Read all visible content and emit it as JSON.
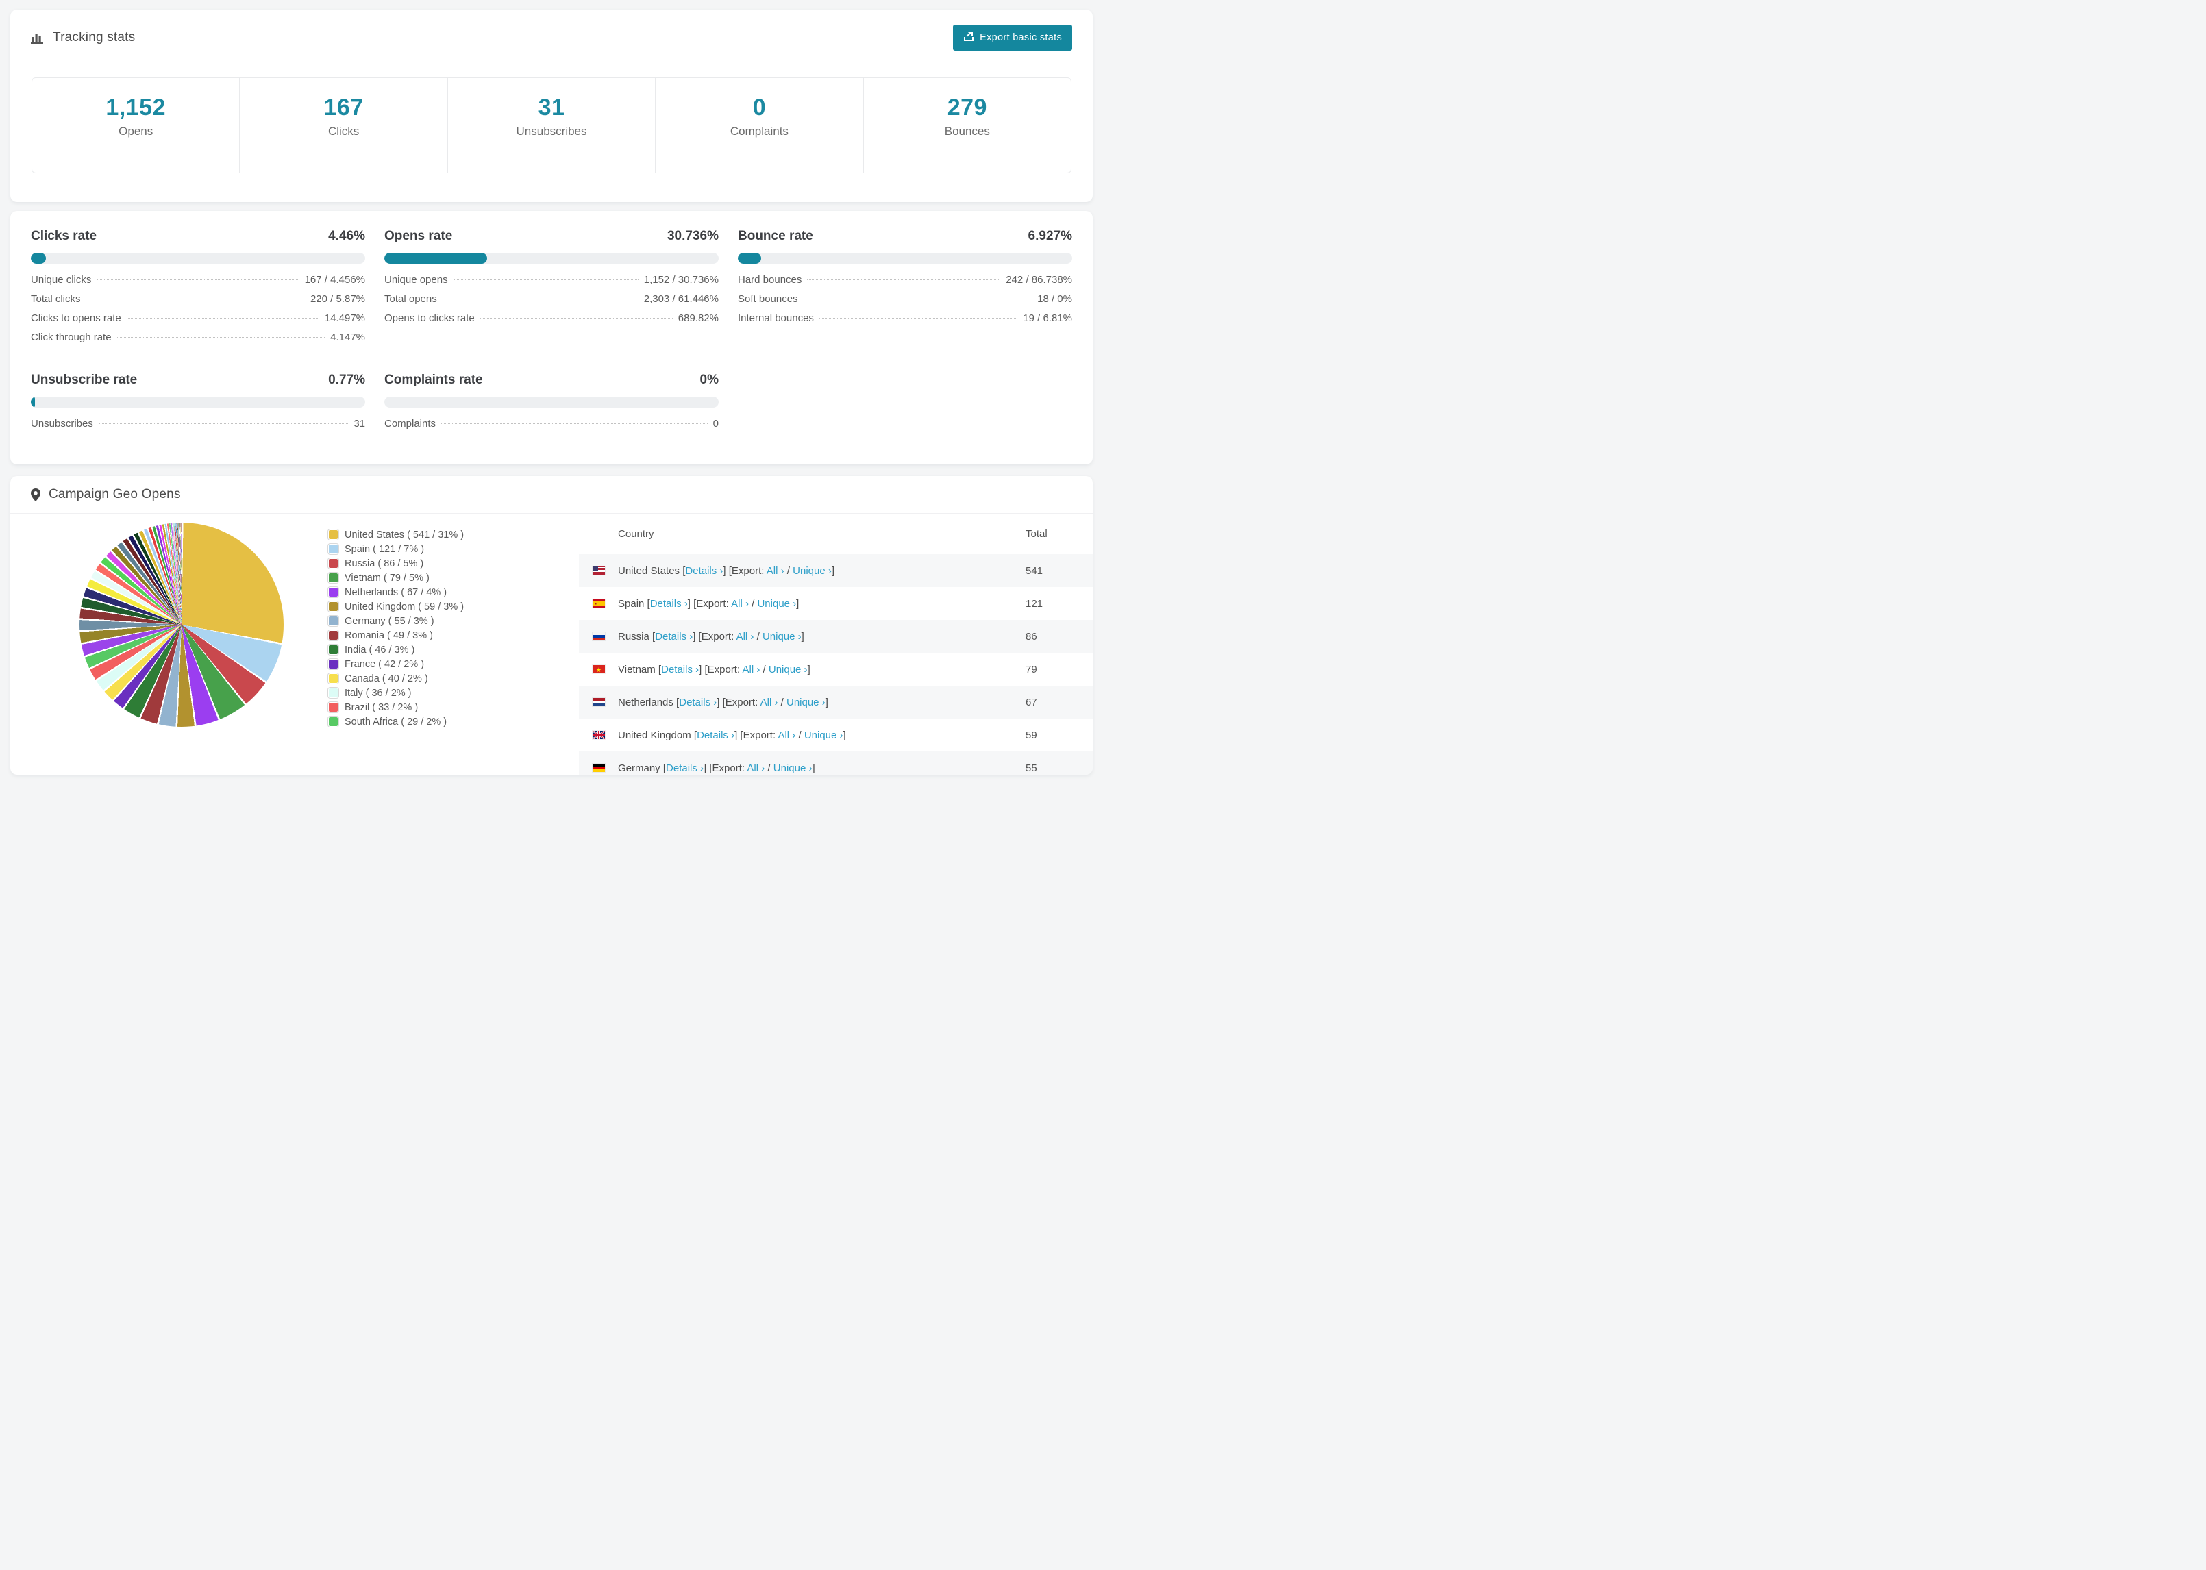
{
  "accent_color": "#14879e",
  "link_color": "#2e9fc9",
  "tracking": {
    "title": "Tracking stats",
    "export_button": "Export basic stats",
    "stats": [
      {
        "value": "1,152",
        "label": "Opens"
      },
      {
        "value": "167",
        "label": "Clicks"
      },
      {
        "value": "31",
        "label": "Unsubscribes"
      },
      {
        "value": "0",
        "label": "Complaints"
      },
      {
        "value": "279",
        "label": "Bounces"
      }
    ]
  },
  "rates": {
    "blocks": [
      {
        "title": "Clicks rate",
        "value": "4.46%",
        "bar_pct": 4.46,
        "lines": [
          {
            "label": "Unique clicks",
            "value": "167 / 4.456%"
          },
          {
            "label": "Total clicks",
            "value": "220 / 5.87%"
          },
          {
            "label": "Clicks to opens rate",
            "value": "14.497%"
          },
          {
            "label": "Click through rate",
            "value": "4.147%"
          }
        ]
      },
      {
        "title": "Opens rate",
        "value": "30.736%",
        "bar_pct": 30.736,
        "lines": [
          {
            "label": "Unique opens",
            "value": "1,152 / 30.736%"
          },
          {
            "label": "Total opens",
            "value": "2,303 / 61.446%"
          },
          {
            "label": "Opens to clicks rate",
            "value": "689.82%"
          }
        ]
      },
      {
        "title": "Bounce rate",
        "value": "6.927%",
        "bar_pct": 6.927,
        "lines": [
          {
            "label": "Hard bounces",
            "value": "242 / 86.738%"
          },
          {
            "label": "Soft bounces",
            "value": "18 / 0%"
          },
          {
            "label": "Internal bounces",
            "value": "19 / 6.81%"
          }
        ]
      },
      {
        "title": "Unsubscribe rate",
        "value": "0.77%",
        "bar_pct": 0.77,
        "lines": [
          {
            "label": "Unsubscribes",
            "value": "31"
          }
        ]
      },
      {
        "title": "Complaints rate",
        "value": "0%",
        "bar_pct": 0,
        "lines": [
          {
            "label": "Complaints",
            "value": "0"
          }
        ]
      }
    ]
  },
  "geo": {
    "title": "Campaign Geo Opens",
    "table": {
      "col_country": "Country",
      "col_total": "Total",
      "details_label": "Details ›",
      "export_label": "Export:",
      "all_label": "All ›",
      "unique_label": "Unique ›",
      "rows": [
        {
          "country": "United States",
          "flag": "us",
          "total": "541"
        },
        {
          "country": "Spain",
          "flag": "es",
          "total": "121"
        },
        {
          "country": "Russia",
          "flag": "ru",
          "total": "86"
        },
        {
          "country": "Vietnam",
          "flag": "vn",
          "total": "79"
        },
        {
          "country": "Netherlands",
          "flag": "nl",
          "total": "67"
        },
        {
          "country": "United Kingdom",
          "flag": "gb",
          "total": "59"
        },
        {
          "country": "Germany",
          "flag": "de",
          "total": "55"
        }
      ]
    }
  },
  "chart_data": {
    "type": "pie",
    "title": "Campaign Geo Opens",
    "legend_position": "right-of-pie",
    "start_angle_deg": 0,
    "slices": [
      {
        "label": "United States",
        "count": 541,
        "pct": 31,
        "color": "#e5bf44"
      },
      {
        "label": "Spain",
        "count": 121,
        "pct": 7,
        "color": "#abd4f0"
      },
      {
        "label": "Russia",
        "count": 86,
        "pct": 5,
        "color": "#c9484d"
      },
      {
        "label": "Vietnam",
        "count": 79,
        "pct": 5,
        "color": "#47a14b"
      },
      {
        "label": "Netherlands",
        "count": 67,
        "pct": 4,
        "color": "#9b3ef0"
      },
      {
        "label": "United Kingdom",
        "count": 59,
        "pct": 3,
        "color": "#b2922f"
      },
      {
        "label": "Germany",
        "count": 55,
        "pct": 3,
        "color": "#92b3cf"
      },
      {
        "label": "Romania",
        "count": 49,
        "pct": 3,
        "color": "#a03a3c"
      },
      {
        "label": "India",
        "count": 46,
        "pct": 3,
        "color": "#2e7d36"
      },
      {
        "label": "France",
        "count": 42,
        "pct": 2,
        "color": "#6a2fc0"
      },
      {
        "label": "Canada",
        "count": 40,
        "pct": 2,
        "color": "#f7df4e"
      },
      {
        "label": "Italy",
        "count": 36,
        "pct": 2,
        "color": "#dcfcf6"
      },
      {
        "label": "Brazil",
        "count": 33,
        "pct": 2,
        "color": "#f25f5f"
      },
      {
        "label": "South Africa",
        "count": 29,
        "pct": 2,
        "color": "#57c964"
      }
    ],
    "other_slices_pct": [
      1.55,
      1.45,
      1.38,
      1.3,
      1.22,
      1.15,
      1.08,
      1.0,
      0.94,
      0.88,
      0.82,
      0.76,
      0.7,
      0.64,
      0.58,
      0.53,
      0.48,
      0.43,
      0.38,
      0.34,
      0.3,
      0.27,
      0.24,
      0.21,
      0.18,
      0.16,
      0.14,
      0.12,
      0.1,
      0.09,
      0.08,
      0.07,
      0.06,
      0.05,
      0.05,
      0.04,
      0.04,
      0.03,
      0.03,
      0.02,
      0.02,
      0.02,
      0.01,
      0.01,
      0.01
    ],
    "other_colors": [
      "#9b44ea",
      "#968428",
      "#6f8fa5",
      "#8a3434",
      "#1f5c2d",
      "#2b2b72",
      "#f4ec3f",
      "#e8fcf8",
      "#fa6a63",
      "#52d455",
      "#d74ae8",
      "#8f7d1e",
      "#5d7f93",
      "#6e2424",
      "#19195c",
      "#123f1c",
      "#d9b52c",
      "#a6cdf0",
      "#e33d3d",
      "#3cab44",
      "#8833dd",
      "#e23de8",
      "#c1a51f",
      "#90c8ec",
      "#ff6b6b",
      "#63d977",
      "#b06ef5",
      "#f2a5d0",
      "#7cd6c8",
      "#cc4444",
      "#4a90d9",
      "#e8803a",
      "#7a5230",
      "#3aa6a0",
      "#c2c2c2",
      "#555fb0",
      "#d46a9e",
      "#86b33a",
      "#b08ae0",
      "#e0d05a",
      "#9b44ea",
      "#968428",
      "#6f8fa5",
      "#8a3434",
      "#1f5c2d"
    ]
  }
}
